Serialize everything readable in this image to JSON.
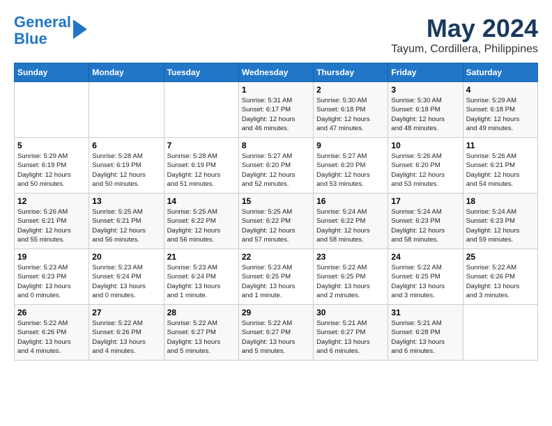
{
  "logo": {
    "line1": "General",
    "line2": "Blue"
  },
  "title": "May 2024",
  "location": "Tayum, Cordillera, Philippines",
  "weekdays": [
    "Sunday",
    "Monday",
    "Tuesday",
    "Wednesday",
    "Thursday",
    "Friday",
    "Saturday"
  ],
  "weeks": [
    [
      {
        "day": "",
        "info": ""
      },
      {
        "day": "",
        "info": ""
      },
      {
        "day": "",
        "info": ""
      },
      {
        "day": "1",
        "info": "Sunrise: 5:31 AM\nSunset: 6:17 PM\nDaylight: 12 hours\nand 46 minutes."
      },
      {
        "day": "2",
        "info": "Sunrise: 5:30 AM\nSunset: 6:18 PM\nDaylight: 12 hours\nand 47 minutes."
      },
      {
        "day": "3",
        "info": "Sunrise: 5:30 AM\nSunset: 6:18 PM\nDaylight: 12 hours\nand 48 minutes."
      },
      {
        "day": "4",
        "info": "Sunrise: 5:29 AM\nSunset: 6:18 PM\nDaylight: 12 hours\nand 49 minutes."
      }
    ],
    [
      {
        "day": "5",
        "info": "Sunrise: 5:29 AM\nSunset: 6:19 PM\nDaylight: 12 hours\nand 50 minutes."
      },
      {
        "day": "6",
        "info": "Sunrise: 5:28 AM\nSunset: 6:19 PM\nDaylight: 12 hours\nand 50 minutes."
      },
      {
        "day": "7",
        "info": "Sunrise: 5:28 AM\nSunset: 6:19 PM\nDaylight: 12 hours\nand 51 minutes."
      },
      {
        "day": "8",
        "info": "Sunrise: 5:27 AM\nSunset: 6:20 PM\nDaylight: 12 hours\nand 52 minutes."
      },
      {
        "day": "9",
        "info": "Sunrise: 5:27 AM\nSunset: 6:20 PM\nDaylight: 12 hours\nand 53 minutes."
      },
      {
        "day": "10",
        "info": "Sunrise: 5:26 AM\nSunset: 6:20 PM\nDaylight: 12 hours\nand 53 minutes."
      },
      {
        "day": "11",
        "info": "Sunrise: 5:26 AM\nSunset: 6:21 PM\nDaylight: 12 hours\nand 54 minutes."
      }
    ],
    [
      {
        "day": "12",
        "info": "Sunrise: 5:26 AM\nSunset: 6:21 PM\nDaylight: 12 hours\nand 55 minutes."
      },
      {
        "day": "13",
        "info": "Sunrise: 5:25 AM\nSunset: 6:21 PM\nDaylight: 12 hours\nand 56 minutes."
      },
      {
        "day": "14",
        "info": "Sunrise: 5:25 AM\nSunset: 6:22 PM\nDaylight: 12 hours\nand 56 minutes."
      },
      {
        "day": "15",
        "info": "Sunrise: 5:25 AM\nSunset: 6:22 PM\nDaylight: 12 hours\nand 57 minutes."
      },
      {
        "day": "16",
        "info": "Sunrise: 5:24 AM\nSunset: 6:22 PM\nDaylight: 12 hours\nand 58 minutes."
      },
      {
        "day": "17",
        "info": "Sunrise: 5:24 AM\nSunset: 6:23 PM\nDaylight: 12 hours\nand 58 minutes."
      },
      {
        "day": "18",
        "info": "Sunrise: 5:24 AM\nSunset: 6:23 PM\nDaylight: 12 hours\nand 59 minutes."
      }
    ],
    [
      {
        "day": "19",
        "info": "Sunrise: 5:23 AM\nSunset: 6:23 PM\nDaylight: 13 hours\nand 0 minutes."
      },
      {
        "day": "20",
        "info": "Sunrise: 5:23 AM\nSunset: 6:24 PM\nDaylight: 13 hours\nand 0 minutes."
      },
      {
        "day": "21",
        "info": "Sunrise: 5:23 AM\nSunset: 6:24 PM\nDaylight: 13 hours\nand 1 minute."
      },
      {
        "day": "22",
        "info": "Sunrise: 5:23 AM\nSunset: 6:25 PM\nDaylight: 13 hours\nand 1 minute."
      },
      {
        "day": "23",
        "info": "Sunrise: 5:22 AM\nSunset: 6:25 PM\nDaylight: 13 hours\nand 2 minutes."
      },
      {
        "day": "24",
        "info": "Sunrise: 5:22 AM\nSunset: 6:25 PM\nDaylight: 13 hours\nand 3 minutes."
      },
      {
        "day": "25",
        "info": "Sunrise: 5:22 AM\nSunset: 6:26 PM\nDaylight: 13 hours\nand 3 minutes."
      }
    ],
    [
      {
        "day": "26",
        "info": "Sunrise: 5:22 AM\nSunset: 6:26 PM\nDaylight: 13 hours\nand 4 minutes."
      },
      {
        "day": "27",
        "info": "Sunrise: 5:22 AM\nSunset: 6:26 PM\nDaylight: 13 hours\nand 4 minutes."
      },
      {
        "day": "28",
        "info": "Sunrise: 5:22 AM\nSunset: 6:27 PM\nDaylight: 13 hours\nand 5 minutes."
      },
      {
        "day": "29",
        "info": "Sunrise: 5:22 AM\nSunset: 6:27 PM\nDaylight: 13 hours\nand 5 minutes."
      },
      {
        "day": "30",
        "info": "Sunrise: 5:21 AM\nSunset: 6:27 PM\nDaylight: 13 hours\nand 6 minutes."
      },
      {
        "day": "31",
        "info": "Sunrise: 5:21 AM\nSunset: 6:28 PM\nDaylight: 13 hours\nand 6 minutes."
      },
      {
        "day": "",
        "info": ""
      }
    ]
  ]
}
